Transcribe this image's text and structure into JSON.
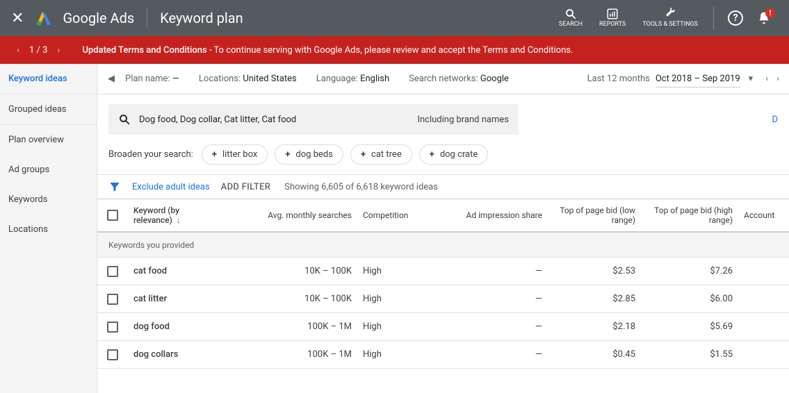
{
  "header": {
    "brand": "Google Ads",
    "page": "Keyword plan",
    "tools": [
      {
        "label": "SEARCH"
      },
      {
        "label": "REPORTS"
      },
      {
        "label": "TOOLS & SETTINGS"
      }
    ],
    "bell_badge": "!"
  },
  "notification": {
    "count": "1 / 3",
    "bold": "Updated Terms and Conditions",
    "rest": " - To continue serving with Google Ads, please review and accept the Terms and Conditions."
  },
  "sidebar": [
    {
      "label": "Keyword ideas",
      "active": true
    },
    {
      "label": "Grouped ideas"
    },
    {
      "label": "Plan overview"
    },
    {
      "label": "Ad groups"
    },
    {
      "label": "Keywords"
    },
    {
      "label": "Locations"
    }
  ],
  "planbar": {
    "plan_label": "Plan name:",
    "plan_value": "—",
    "loc_label": "Locations:",
    "loc_value": "United States",
    "lang_label": "Language:",
    "lang_value": "English",
    "net_label": "Search networks:",
    "net_value": "Google",
    "range_label": "Last 12 months",
    "range_value": "Oct 2018 – Sep 2019"
  },
  "searchbox": {
    "text": "Dog food, Dog collar, Cat litter, Cat food",
    "brand": "Including brand names"
  },
  "download_partial": "D",
  "broaden": {
    "label": "Broaden your search:",
    "chips": [
      "litter box",
      "dog beds",
      "cat tree",
      "dog crate"
    ]
  },
  "filter": {
    "exclude": "Exclude adult ideas",
    "add": "ADD FILTER",
    "count": "Showing 6,605 of 6,618 keyword ideas"
  },
  "table": {
    "columns": {
      "keyword": "Keyword (by relevance)",
      "searches": "Avg. monthly searches",
      "competition": "Competition",
      "impression": "Ad impression share",
      "bidlow": "Top of page bid (low range)",
      "bidhigh": "Top of page bid (high range)",
      "account": "Account"
    },
    "section": "Keywords you provided",
    "rows": [
      {
        "kw": "cat food",
        "searches": "10K – 100K",
        "comp": "High",
        "impr": "—",
        "low": "$2.53",
        "high": "$7.26"
      },
      {
        "kw": "cat litter",
        "searches": "10K – 100K",
        "comp": "High",
        "impr": "—",
        "low": "$2.85",
        "high": "$6.00"
      },
      {
        "kw": "dog food",
        "searches": "100K – 1M",
        "comp": "High",
        "impr": "—",
        "low": "$2.18",
        "high": "$5.69"
      },
      {
        "kw": "dog collars",
        "searches": "100K – 1M",
        "comp": "High",
        "impr": "—",
        "low": "$0.45",
        "high": "$1.55"
      }
    ]
  }
}
